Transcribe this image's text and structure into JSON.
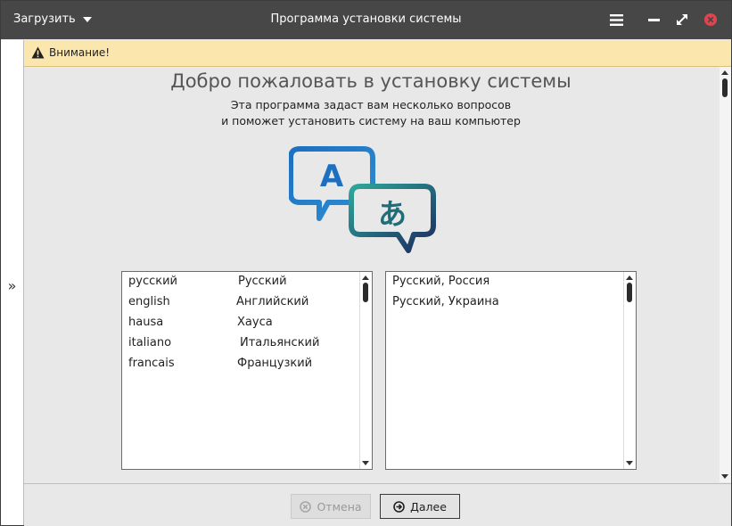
{
  "titlebar": {
    "menu_label": "Загрузить",
    "title": "Программа установки системы"
  },
  "warning": {
    "text": "Внимание!"
  },
  "welcome": {
    "heading": "Добро пожаловать в установку системы",
    "subtitle_line1": "Эта программа задаст вам несколько вопросов",
    "subtitle_line2": "и поможет установить систему на ваш компьютер",
    "logo_letters": [
      "A",
      "あ"
    ]
  },
  "languages": [
    {
      "native": "русский",
      "localized": "Русский"
    },
    {
      "native": "english",
      "localized": "Английский"
    },
    {
      "native": "hausa",
      "localized": "Хауса"
    },
    {
      "native": "italiano",
      "localized": "Итальянский"
    },
    {
      "native": "francais",
      "localized": "Французкий"
    }
  ],
  "regions": [
    "Русский, Россия",
    "Русский, Украина"
  ],
  "buttons": {
    "cancel": "Отмена",
    "next": "Далее"
  },
  "colors": {
    "titlebar": "#474747",
    "warning_bg": "#fbe7ad",
    "close": "#e0454f",
    "logo_blue": "#1d6fc0",
    "logo_teal": "#2da79a",
    "logo_navy": "#1c2a5e"
  }
}
